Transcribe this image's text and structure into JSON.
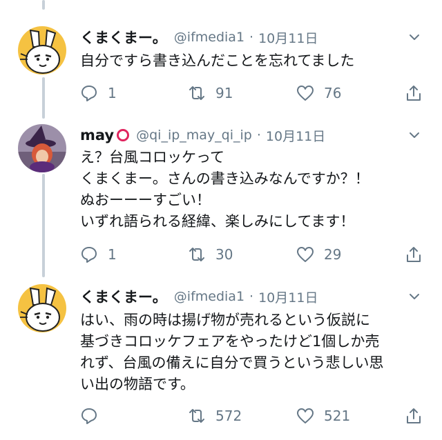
{
  "tweets": [
    {
      "name": "くまくまー。",
      "handle": "@ifmedia1",
      "date": "10月11日",
      "text": "自分ですら書き込んだことを忘れてました",
      "replies": "1",
      "retweets": "91",
      "likes": "76"
    },
    {
      "name": "may",
      "handle": "@qi_ip_may_qi_ip",
      "date": "10月11日",
      "text": "え？台風コロッケって\nくまくまー。さんの書き込みなんですか？！\nぬおーーーすごい！\nいずれ語られる経緯、楽しみにしてます！",
      "replies": "1",
      "retweets": "30",
      "likes": "29"
    },
    {
      "name": "くまくまー。",
      "handle": "@ifmedia1",
      "date": "10月11日",
      "text": "はい、雨の時は揚げ物が売れるという仮説に\n基づきコロッケフェアをやったけど1個しか売\nれず、台風の備えに自分で買うという悲しい思\nい出の物語です。",
      "replies": "",
      "retweets": "572",
      "likes": "521"
    }
  ],
  "colors": {
    "text": "#14171a",
    "muted": "#657786",
    "thread_line": "#c7d0d8",
    "status_mark": "#e0245e"
  },
  "icons": [
    "reply-icon",
    "retweet-icon",
    "like-icon",
    "share-icon",
    "chevron-down-icon"
  ]
}
